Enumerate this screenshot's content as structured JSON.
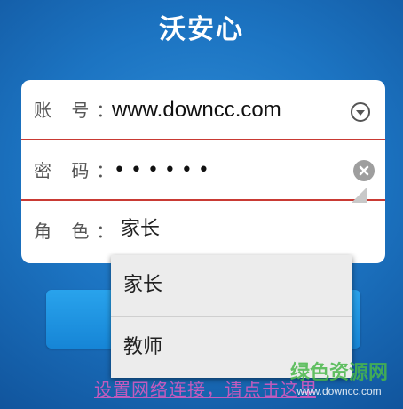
{
  "app": {
    "title": "沃安心"
  },
  "form": {
    "account": {
      "label": "账 号：",
      "value": "www.downcc.com",
      "dropdown_icon": "chevron-down-circle-icon"
    },
    "password": {
      "label": "密 码：",
      "value": "••••••",
      "clear_icon": "clear-circle-icon"
    },
    "role": {
      "label": "角 色：",
      "value": "家长"
    }
  },
  "role_menu": {
    "items": [
      {
        "label": "家长"
      },
      {
        "label": "教师"
      }
    ]
  },
  "bottom_link": {
    "text": "设置网络连接，请点击这里"
  },
  "watermark": {
    "title": "绿色资源网",
    "url": "www.downcc.com"
  },
  "colors": {
    "background": "#1c74c2",
    "divider_red": "#c93a34",
    "button_blue": "#1c8ee0",
    "link_purple": "#c25bbd",
    "watermark_green": "#49b84a"
  }
}
